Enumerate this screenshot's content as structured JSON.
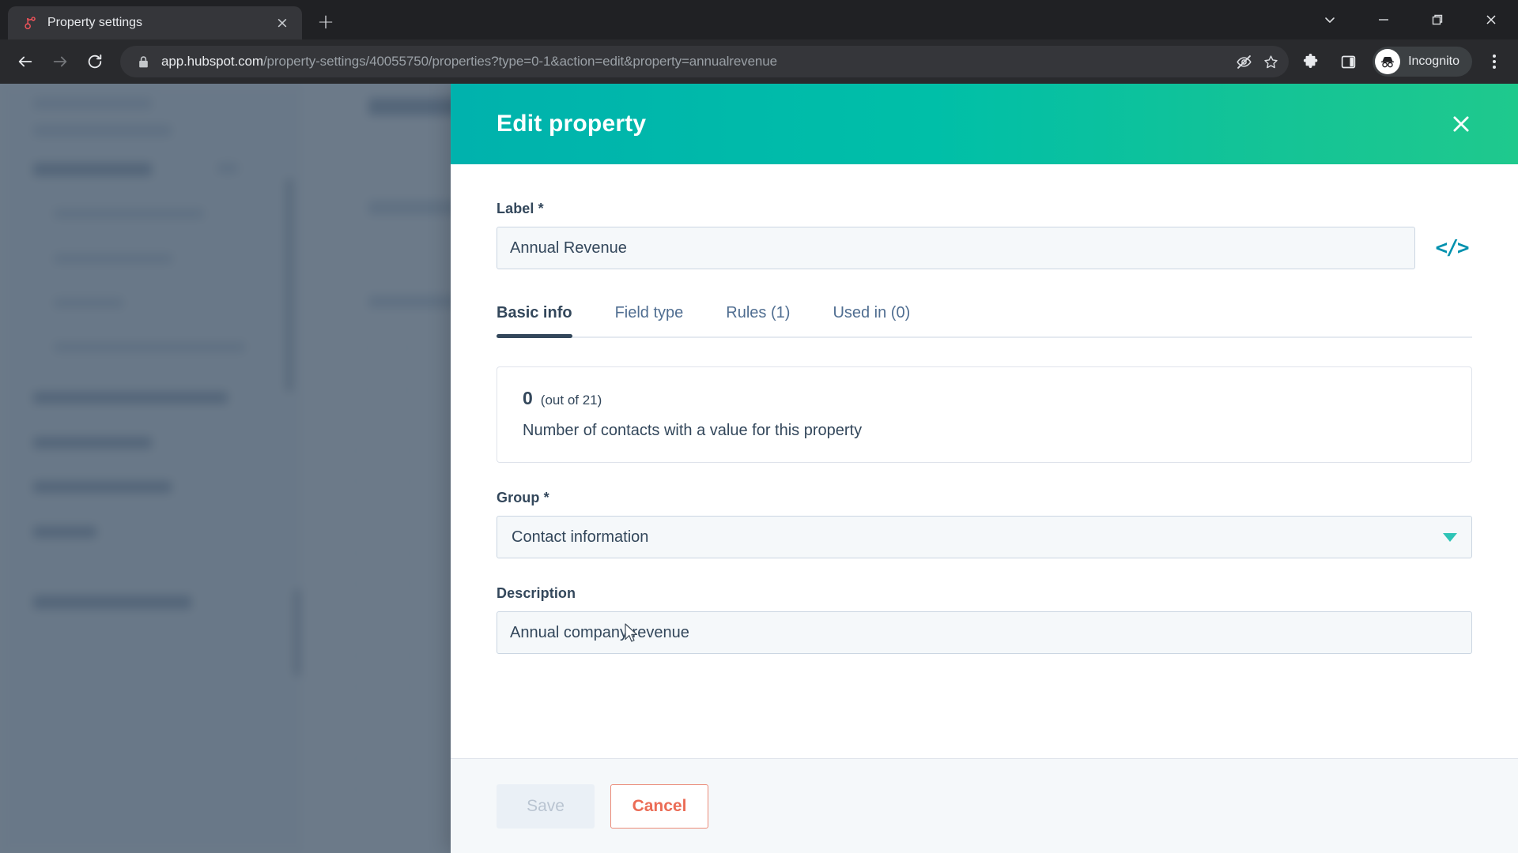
{
  "browser": {
    "tab": {
      "title": "Property settings",
      "favicon": "hubspot-sprocket-icon",
      "close_label": "×"
    },
    "new_tab_label": "+",
    "window_controls": [
      "chevron-down-icon",
      "minimize-icon",
      "restore-icon",
      "close-icon"
    ],
    "nav": {
      "back": "back-arrow-icon",
      "forward": "forward-arrow-icon",
      "reload": "reload-icon"
    },
    "omnibox": {
      "lock": "lock-icon",
      "url_host": "app.hubspot.com",
      "url_path": "/property-settings/40055750/properties?type=0-1&action=edit&property=annualrevenue",
      "tracking_icon": "eye-off-icon",
      "bookmark_icon": "star-icon"
    },
    "toolbar_icons": [
      "extensions-puzzle-icon",
      "side-panel-icon"
    ],
    "profile": {
      "label": "Incognito",
      "avatar": "incognito-hat-icon"
    },
    "menu": "kebab-menu-icon"
  },
  "modal": {
    "title": "Edit property",
    "close": "close-icon",
    "label_field": {
      "label": "Label *",
      "value": "Annual Revenue",
      "placeholder": "Label",
      "code_icon": "</>"
    },
    "tabs": [
      {
        "label": "Basic info",
        "active": true
      },
      {
        "label": "Field type",
        "active": false
      },
      {
        "label": "Rules (1)",
        "active": false
      },
      {
        "label": "Used in (0)",
        "active": false
      }
    ],
    "usage_card": {
      "count": "0",
      "total": "(out of 21)",
      "description": "Number of contacts with a value for this property"
    },
    "group_field": {
      "label": "Group *",
      "value": "Contact information",
      "caret": "chevron-down-icon"
    },
    "description_field": {
      "label": "Description",
      "value": "Annual company revenue",
      "placeholder": "Description"
    },
    "footer": {
      "save_label": "Save",
      "cancel_label": "Cancel"
    }
  },
  "colors": {
    "header_gradient_start": "#00b2ad",
    "header_gradient_end": "#1fc98d",
    "accent_teal": "#0091ae",
    "cancel_orange": "#eb6c56",
    "text_primary": "#33475b",
    "scrim": "#33475b"
  }
}
